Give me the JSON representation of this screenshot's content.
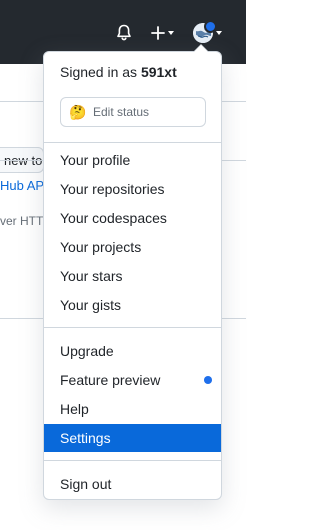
{
  "header": {
    "notifications_icon": "bell-icon",
    "create_icon": "plus-icon",
    "avatar_icon": "avatar-icon",
    "accent": "#1f6feb"
  },
  "background": {
    "button_fragment": "new tol",
    "link_fragment": "Hub AP",
    "text_fragment": "ver HTT"
  },
  "dropdown": {
    "signed_in_prefix": "Signed in as",
    "username": "591xt",
    "status": {
      "emoji": "🤔",
      "label": "Edit status"
    },
    "group1": [
      {
        "label": "Your profile"
      },
      {
        "label": "Your repositories"
      },
      {
        "label": "Your codespaces"
      },
      {
        "label": "Your projects"
      },
      {
        "label": "Your stars"
      },
      {
        "label": "Your gists"
      }
    ],
    "group2": [
      {
        "label": "Upgrade"
      },
      {
        "label": "Feature preview"
      },
      {
        "label": "Help"
      },
      {
        "label": "Settings"
      }
    ],
    "sign_out": "Sign out",
    "active_item": "Settings",
    "active_color": "#0969da"
  }
}
